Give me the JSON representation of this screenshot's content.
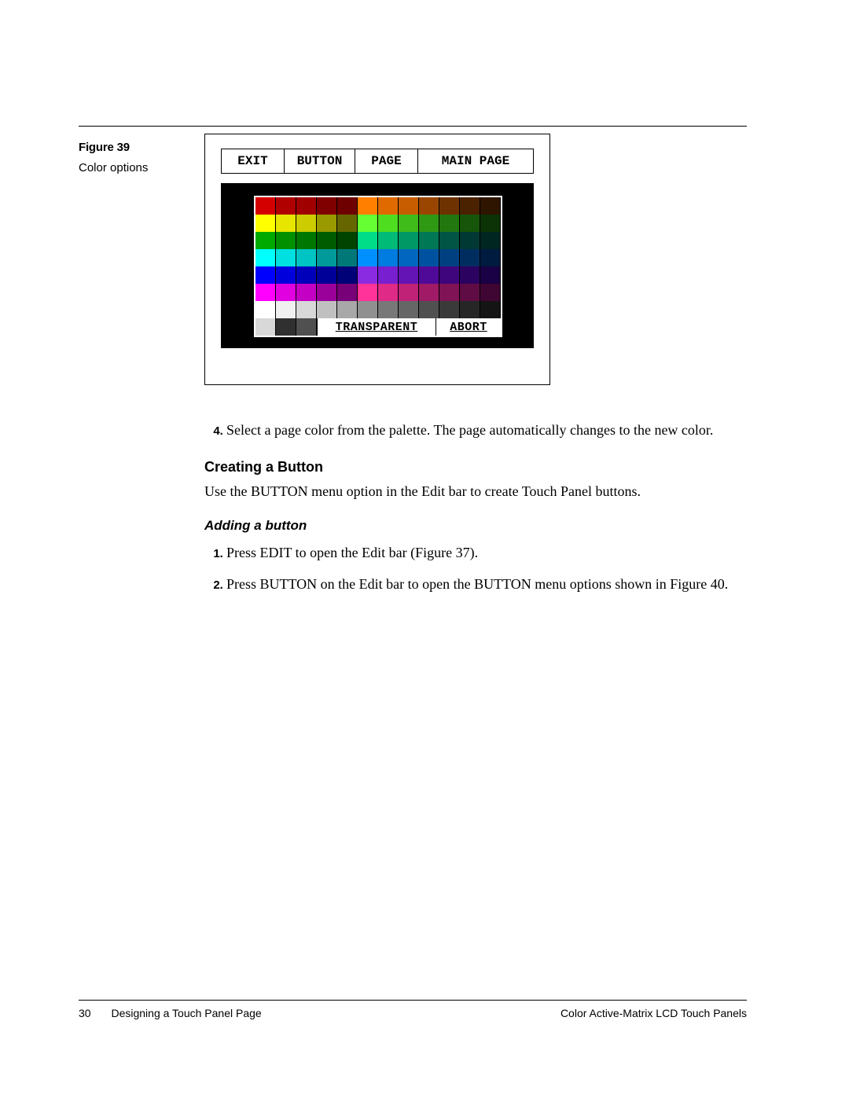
{
  "figure": {
    "label": "Figure 39",
    "caption": "Color options",
    "menubar": {
      "exit": "EXIT",
      "button": "BUTTON",
      "page": "PAGE",
      "main_page": "MAIN PAGE"
    },
    "palette": {
      "rows": [
        [
          "#d40000",
          "#b00000",
          "#a00000",
          "#800000",
          "#6e0000",
          "#ff7f00",
          "#e06a00",
          "#c85d00",
          "#9a4600",
          "#6e3200",
          "#4a2200",
          "#2e1500"
        ],
        [
          "#ffff00",
          "#e6e600",
          "#cccc00",
          "#999900",
          "#666600",
          "#66ff33",
          "#4fdd1f",
          "#3fbb1a",
          "#2f9914",
          "#23770f",
          "#17550a",
          "#0b3305"
        ],
        [
          "#00aa00",
          "#009000",
          "#007700",
          "#005c00",
          "#004400",
          "#00dd88",
          "#00bb77",
          "#009966",
          "#007755",
          "#005544",
          "#003833",
          "#002622"
        ],
        [
          "#00ffff",
          "#00e0e0",
          "#00c4c4",
          "#009a9a",
          "#007878",
          "#0090ff",
          "#007be0",
          "#0066c0",
          "#0052a0",
          "#003f80",
          "#002d60",
          "#001b40"
        ],
        [
          "#0000ff",
          "#0000dd",
          "#0000bb",
          "#000099",
          "#000077",
          "#8a2be2",
          "#781fd0",
          "#6414b4",
          "#500a98",
          "#3e057c",
          "#2c0260",
          "#1a0044"
        ],
        [
          "#ff00ff",
          "#e000e0",
          "#c400c4",
          "#9a009a",
          "#780078",
          "#ff3399",
          "#e02a88",
          "#c02277",
          "#a01a66",
          "#801355",
          "#600c44",
          "#400633"
        ],
        [
          "#ffffff",
          "#f0f0f0",
          "#d8d8d8",
          "#c0c0c0",
          "#a8a8a8",
          "#909090",
          "#787878",
          "#666666",
          "#505050",
          "#3a3a3a",
          "#262626",
          "#141414"
        ]
      ],
      "bottom": {
        "left_cells": [
          "#d8d8d8",
          "#303030",
          "#505050"
        ],
        "transparent_label": "TRANSPARENT",
        "abort_label": "ABORT"
      }
    }
  },
  "body": {
    "item4": "Select a page color from the palette. The page automatically changes to the new color.",
    "section_heading": "Creating a Button",
    "section_para": "Use the BUTTON menu option in the Edit bar to create Touch Panel buttons.",
    "subsection_heading": "Adding a button",
    "steps": [
      "Press EDIT to open the Edit bar (Figure 37).",
      "Press BUTTON on the Edit bar to open the BUTTON menu options shown in Figure 40."
    ]
  },
  "footer": {
    "page_number": "30",
    "left": "Designing a Touch Panel Page",
    "right": "Color Active-Matrix LCD Touch Panels"
  }
}
